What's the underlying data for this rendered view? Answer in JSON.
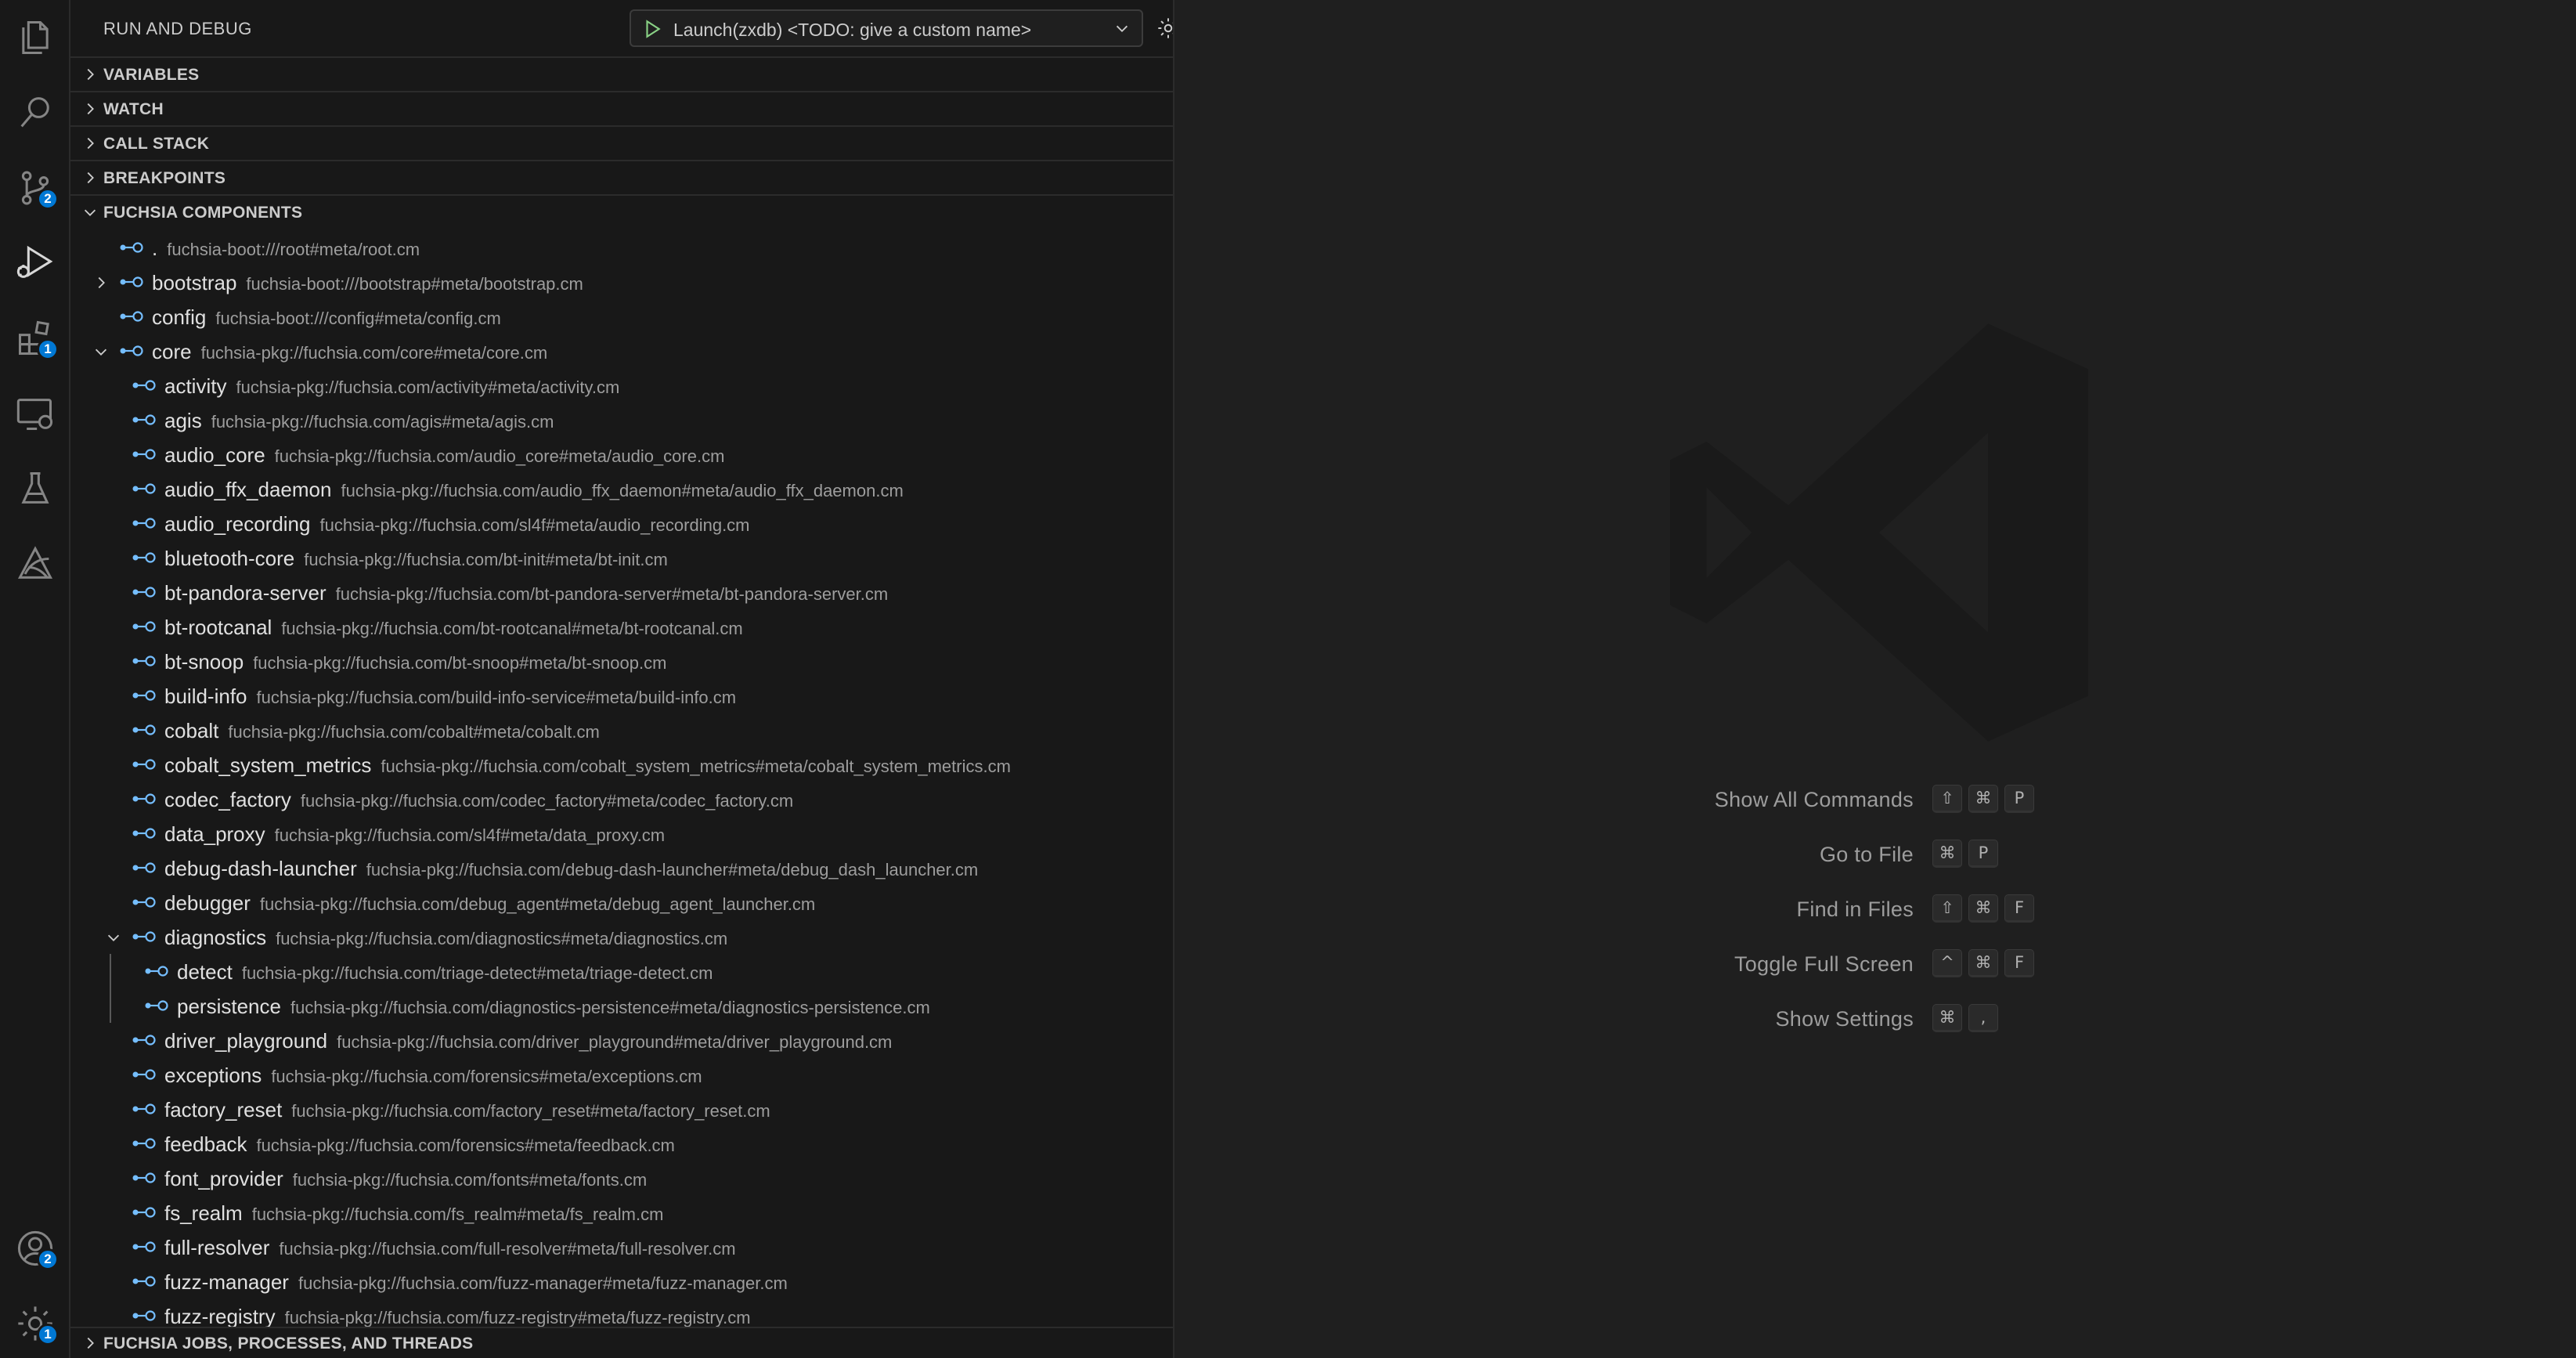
{
  "activity_bar": {
    "scm_badge": "2",
    "extensions_badge": "1",
    "accounts_badge": "2",
    "manage_badge": "1"
  },
  "sidebar": {
    "title": "RUN AND DEBUG",
    "launch_config": "Launch(zxdb) <TODO: give a custom name>",
    "sections": {
      "variables": "VARIABLES",
      "watch": "WATCH",
      "call_stack": "CALL STACK",
      "breakpoints": "BREAKPOINTS",
      "fuchsia_components": "FUCHSIA COMPONENTS",
      "fuchsia_jobs": "FUCHSIA JOBS, PROCESSES, AND THREADS"
    }
  },
  "components": [
    {
      "name": ".",
      "url": "fuchsia-boot:///root#meta/root.cm",
      "depth": 0,
      "chevron": "none"
    },
    {
      "name": "bootstrap",
      "url": "fuchsia-boot:///bootstrap#meta/bootstrap.cm",
      "depth": 0,
      "chevron": "right"
    },
    {
      "name": "config",
      "url": "fuchsia-boot:///config#meta/config.cm",
      "depth": 0,
      "chevron": "none"
    },
    {
      "name": "core",
      "url": "fuchsia-pkg://fuchsia.com/core#meta/core.cm",
      "depth": 0,
      "chevron": "down"
    },
    {
      "name": "activity",
      "url": "fuchsia-pkg://fuchsia.com/activity#meta/activity.cm",
      "depth": 1,
      "chevron": "none"
    },
    {
      "name": "agis",
      "url": "fuchsia-pkg://fuchsia.com/agis#meta/agis.cm",
      "depth": 1,
      "chevron": "none"
    },
    {
      "name": "audio_core",
      "url": "fuchsia-pkg://fuchsia.com/audio_core#meta/audio_core.cm",
      "depth": 1,
      "chevron": "none"
    },
    {
      "name": "audio_ffx_daemon",
      "url": "fuchsia-pkg://fuchsia.com/audio_ffx_daemon#meta/audio_ffx_daemon.cm",
      "depth": 1,
      "chevron": "none"
    },
    {
      "name": "audio_recording",
      "url": "fuchsia-pkg://fuchsia.com/sl4f#meta/audio_recording.cm",
      "depth": 1,
      "chevron": "none"
    },
    {
      "name": "bluetooth-core",
      "url": "fuchsia-pkg://fuchsia.com/bt-init#meta/bt-init.cm",
      "depth": 1,
      "chevron": "none"
    },
    {
      "name": "bt-pandora-server",
      "url": "fuchsia-pkg://fuchsia.com/bt-pandora-server#meta/bt-pandora-server.cm",
      "depth": 1,
      "chevron": "none"
    },
    {
      "name": "bt-rootcanal",
      "url": "fuchsia-pkg://fuchsia.com/bt-rootcanal#meta/bt-rootcanal.cm",
      "depth": 1,
      "chevron": "none"
    },
    {
      "name": "bt-snoop",
      "url": "fuchsia-pkg://fuchsia.com/bt-snoop#meta/bt-snoop.cm",
      "depth": 1,
      "chevron": "none"
    },
    {
      "name": "build-info",
      "url": "fuchsia-pkg://fuchsia.com/build-info-service#meta/build-info.cm",
      "depth": 1,
      "chevron": "none"
    },
    {
      "name": "cobalt",
      "url": "fuchsia-pkg://fuchsia.com/cobalt#meta/cobalt.cm",
      "depth": 1,
      "chevron": "none"
    },
    {
      "name": "cobalt_system_metrics",
      "url": "fuchsia-pkg://fuchsia.com/cobalt_system_metrics#meta/cobalt_system_metrics.cm",
      "depth": 1,
      "chevron": "none"
    },
    {
      "name": "codec_factory",
      "url": "fuchsia-pkg://fuchsia.com/codec_factory#meta/codec_factory.cm",
      "depth": 1,
      "chevron": "none"
    },
    {
      "name": "data_proxy",
      "url": "fuchsia-pkg://fuchsia.com/sl4f#meta/data_proxy.cm",
      "depth": 1,
      "chevron": "none"
    },
    {
      "name": "debug-dash-launcher",
      "url": "fuchsia-pkg://fuchsia.com/debug-dash-launcher#meta/debug_dash_launcher.cm",
      "depth": 1,
      "chevron": "none"
    },
    {
      "name": "debugger",
      "url": "fuchsia-pkg://fuchsia.com/debug_agent#meta/debug_agent_launcher.cm",
      "depth": 1,
      "chevron": "none"
    },
    {
      "name": "diagnostics",
      "url": "fuchsia-pkg://fuchsia.com/diagnostics#meta/diagnostics.cm",
      "depth": 1,
      "chevron": "down"
    },
    {
      "name": "detect",
      "url": "fuchsia-pkg://fuchsia.com/triage-detect#meta/triage-detect.cm",
      "depth": 2,
      "chevron": "none"
    },
    {
      "name": "persistence",
      "url": "fuchsia-pkg://fuchsia.com/diagnostics-persistence#meta/diagnostics-persistence.cm",
      "depth": 2,
      "chevron": "none"
    },
    {
      "name": "driver_playground",
      "url": "fuchsia-pkg://fuchsia.com/driver_playground#meta/driver_playground.cm",
      "depth": 1,
      "chevron": "none"
    },
    {
      "name": "exceptions",
      "url": "fuchsia-pkg://fuchsia.com/forensics#meta/exceptions.cm",
      "depth": 1,
      "chevron": "none"
    },
    {
      "name": "factory_reset",
      "url": "fuchsia-pkg://fuchsia.com/factory_reset#meta/factory_reset.cm",
      "depth": 1,
      "chevron": "none"
    },
    {
      "name": "feedback",
      "url": "fuchsia-pkg://fuchsia.com/forensics#meta/feedback.cm",
      "depth": 1,
      "chevron": "none"
    },
    {
      "name": "font_provider",
      "url": "fuchsia-pkg://fuchsia.com/fonts#meta/fonts.cm",
      "depth": 1,
      "chevron": "none"
    },
    {
      "name": "fs_realm",
      "url": "fuchsia-pkg://fuchsia.com/fs_realm#meta/fs_realm.cm",
      "depth": 1,
      "chevron": "none"
    },
    {
      "name": "full-resolver",
      "url": "fuchsia-pkg://fuchsia.com/full-resolver#meta/full-resolver.cm",
      "depth": 1,
      "chevron": "none"
    },
    {
      "name": "fuzz-manager",
      "url": "fuchsia-pkg://fuchsia.com/fuzz-manager#meta/fuzz-manager.cm",
      "depth": 1,
      "chevron": "none"
    },
    {
      "name": "fuzz-registry",
      "url": "fuchsia-pkg://fuchsia.com/fuzz-registry#meta/fuzz-registry.cm",
      "depth": 1,
      "chevron": "none"
    }
  ],
  "editor": {
    "commands": [
      {
        "label": "Show All Commands",
        "keys": [
          "⇧",
          "⌘",
          "P"
        ]
      },
      {
        "label": "Go to File",
        "keys": [
          "⌘",
          "P"
        ]
      },
      {
        "label": "Find in Files",
        "keys": [
          "⇧",
          "⌘",
          "F"
        ]
      },
      {
        "label": "Toggle Full Screen",
        "keys": [
          "^",
          "⌘",
          "F"
        ]
      },
      {
        "label": "Show Settings",
        "keys": [
          "⌘",
          ","
        ]
      }
    ]
  },
  "colors": {
    "accent": "#0078d4",
    "component_icon": "#75beff",
    "play_green": "#89d185"
  }
}
